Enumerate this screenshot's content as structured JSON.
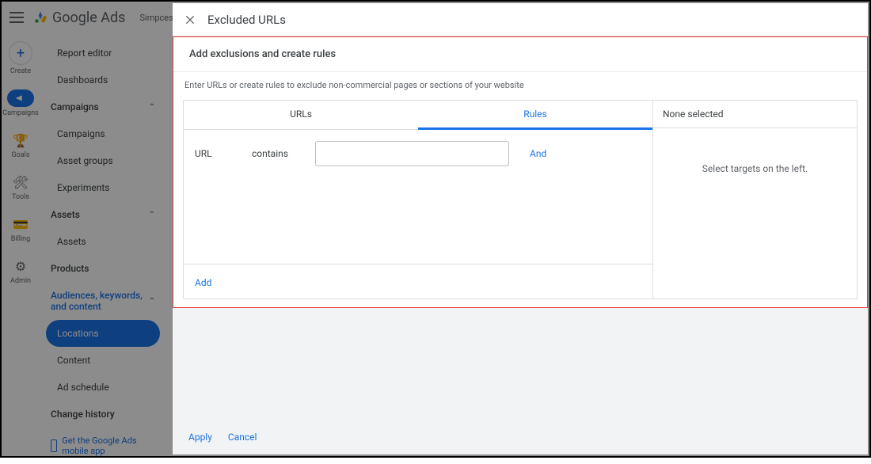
{
  "bg": {
    "brand": "Google Ads",
    "chip": "Simpcess Apps",
    "rail": {
      "create": "Create",
      "campaigns": "Campaigns",
      "goals": "Goals",
      "tools": "Tools",
      "billing": "Billing",
      "admin": "Admin"
    },
    "nav": {
      "report_editor": "Report editor",
      "dashboards": "Dashboards",
      "campaigns_head": "Campaigns",
      "campaigns": "Campaigns",
      "asset_groups": "Asset groups",
      "experiments": "Experiments",
      "assets_head": "Assets",
      "assets": "Assets",
      "products": "Products",
      "akc": "Audiences, keywords, and content",
      "locations": "Locations",
      "content": "Content",
      "ad_schedule": "Ad schedule",
      "change_history": "Change history",
      "get_app": "Get the Google Ads mobile app"
    }
  },
  "panel": {
    "title": "Excluded URLs",
    "section_title": "Add exclusions and create rules",
    "hint": "Enter URLs or create rules to exclude non-commercial pages or sections of your website",
    "tab_urls": "URLs",
    "tab_rules": "Rules",
    "rule_field": "URL",
    "rule_op": "contains",
    "rule_and": "And",
    "add": "Add",
    "none_selected": "None selected",
    "select_prompt": "Select targets on the left.",
    "apply": "Apply",
    "cancel": "Cancel"
  }
}
